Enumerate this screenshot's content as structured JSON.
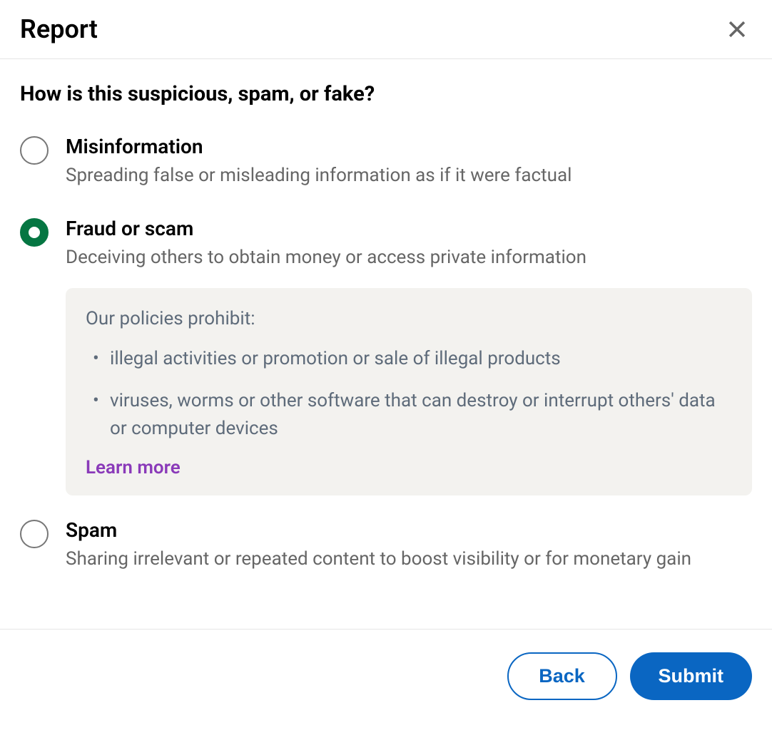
{
  "header": {
    "title": "Report"
  },
  "body": {
    "question": "How is this suspicious, spam, or fake?",
    "options": [
      {
        "id": "misinformation",
        "title": "Misinformation",
        "description": "Spreading false or misleading information as if it were factual",
        "selected": false
      },
      {
        "id": "fraud-scam",
        "title": "Fraud or scam",
        "description": "Deceiving others to obtain money or access private information",
        "selected": true
      },
      {
        "id": "spam",
        "title": "Spam",
        "description": "Sharing irrelevant or repeated content to boost visibility or for monetary gain",
        "selected": false
      }
    ],
    "policy_box": {
      "heading": "Our policies prohibit:",
      "items": [
        "illegal activities or promotion or sale of illegal products",
        "viruses, worms or other software that can destroy or interrupt others' data or computer devices"
      ],
      "learn_more_label": "Learn more"
    }
  },
  "footer": {
    "back_label": "Back",
    "submit_label": "Submit"
  },
  "colors": {
    "accent_green": "#057642",
    "accent_blue": "#0a66c2",
    "link_purple": "#8a3ab9",
    "grey_text": "#666666",
    "policy_bg": "#f3f2ef"
  }
}
